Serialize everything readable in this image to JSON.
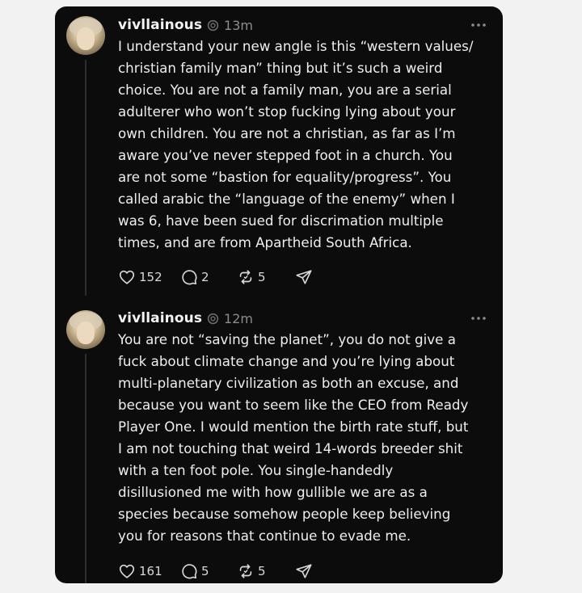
{
  "posts": [
    {
      "username": "vivllainous",
      "time": "13m",
      "lines": [
        "I understand your new angle is this “western values/",
        "christian family man” thing but it’s such a weird",
        "choice. You are not a family man, you are a serial",
        "adulterer who won’t stop fucking lying about your",
        "own children. You are not a christian, as far as I’m",
        "aware you’ve never stepped foot in a church. You",
        "are not some “bastion for equality/progress”. You",
        "called arabic the “language of the enemy” when I",
        "was 6, have been sued for discrimation multiple",
        "times, and are from Apartheid South Africa."
      ],
      "likes": "152",
      "replies": "2",
      "reposts": "5"
    },
    {
      "username": "vivllainous",
      "time": "12m",
      "lines": [
        "You are not “saving the planet”, you do not give a",
        "fuck about climate change and you’re lying about",
        "multi-planetary civilization as both an excuse, and",
        "because you want to seem like the CEO from Ready",
        "Player One. I would mention the birth rate stuff, but",
        "I am not touching that weird 14-words breeder shit",
        "with a ten foot pole. You single-handedly",
        "disillusioned me with how gullible we are as a",
        "species because somehow people keep believing",
        "you for reasons that continue to evade me."
      ],
      "likes": "161",
      "replies": "5",
      "reposts": "5"
    }
  ],
  "icons": {
    "like": "heart-icon",
    "reply": "comment-icon",
    "repost": "repost-icon",
    "share": "share-icon",
    "more": "more-options-icon",
    "verified": "threads-badge-icon"
  },
  "colors": {
    "background": "#0c0c0c",
    "text": "#eeeeee",
    "muted": "#8c8c8c",
    "page": "#f2f2f2"
  }
}
